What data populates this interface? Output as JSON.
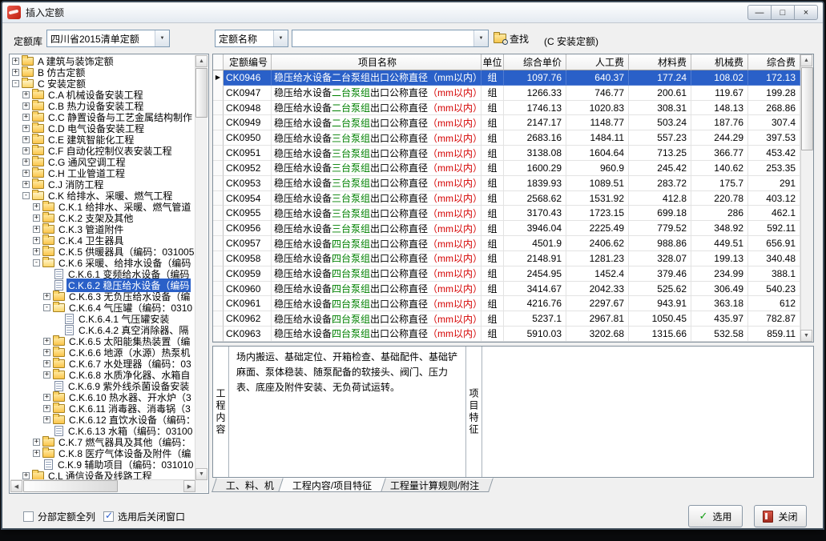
{
  "window": {
    "title": "插入定额",
    "minimize_glyph": "—",
    "maximize_glyph": "□",
    "close_glyph": "×"
  },
  "toolbar": {
    "library_label": "定额库",
    "library_value": "四川省2015清单定额",
    "name_combo_value": "定额名称",
    "search_value": "",
    "find_label": "查找",
    "category_note": "(C 安装定额)"
  },
  "colors": {
    "selection": "#2a60c8",
    "pump_text": "#008000",
    "paren_text": "#d40000"
  },
  "tree": {
    "items": [
      {
        "label": "A 建筑与装饰定额",
        "level": 0,
        "icon": "folder",
        "exp": "plus"
      },
      {
        "label": "B 仿古定额",
        "level": 0,
        "icon": "folder",
        "exp": "plus"
      },
      {
        "label": "C 安装定额",
        "level": 0,
        "icon": "folder-open",
        "exp": "minus"
      },
      {
        "label": "C.A 机械设备安装工程",
        "level": 1,
        "icon": "folder",
        "exp": "plus"
      },
      {
        "label": "C.B 热力设备安装工程",
        "level": 1,
        "icon": "folder",
        "exp": "plus"
      },
      {
        "label": "C.C 静置设备与工艺金属结构制作",
        "level": 1,
        "icon": "folder",
        "exp": "plus"
      },
      {
        "label": "C.D 电气设备安装工程",
        "level": 1,
        "icon": "folder",
        "exp": "plus"
      },
      {
        "label": "C.E 建筑智能化工程",
        "level": 1,
        "icon": "folder",
        "exp": "plus"
      },
      {
        "label": "C.F 自动化控制仪表安装工程",
        "level": 1,
        "icon": "folder",
        "exp": "plus"
      },
      {
        "label": "C.G 通风空调工程",
        "level": 1,
        "icon": "folder",
        "exp": "plus"
      },
      {
        "label": "C.H 工业管道工程",
        "level": 1,
        "icon": "folder",
        "exp": "plus"
      },
      {
        "label": "C.J 消防工程",
        "level": 1,
        "icon": "folder",
        "exp": "plus"
      },
      {
        "label": "C.K 给排水、采暖、燃气工程",
        "level": 1,
        "icon": "folder-open",
        "exp": "minus"
      },
      {
        "label": "C.K.1 给排水、采暖、燃气管道",
        "level": 2,
        "icon": "folder",
        "exp": "plus"
      },
      {
        "label": "C.K.2 支架及其他",
        "level": 2,
        "icon": "folder",
        "exp": "plus"
      },
      {
        "label": "C.K.3 管道附件",
        "level": 2,
        "icon": "folder",
        "exp": "plus"
      },
      {
        "label": "C.K.4 卫生器具",
        "level": 2,
        "icon": "folder",
        "exp": "plus"
      },
      {
        "label": "C.K.5 供暖器具（编码：031005",
        "level": 2,
        "icon": "folder",
        "exp": "plus"
      },
      {
        "label": "C.K.6 采暖、给排水设备（编码",
        "level": 2,
        "icon": "folder-open",
        "exp": "minus"
      },
      {
        "label": "C.K.6.1 变频给水设备（编码",
        "level": 3,
        "icon": "doc",
        "exp": "none"
      },
      {
        "label": "C.K.6.2 稳压给水设备（编码",
        "level": 3,
        "icon": "doc",
        "exp": "none",
        "selected": true
      },
      {
        "label": "C.K.6.3 无负压给水设备（编",
        "level": 3,
        "icon": "folder",
        "exp": "plus"
      },
      {
        "label": "C.K.6.4 气压罐（编码：0310",
        "level": 3,
        "icon": "folder-open",
        "exp": "minus"
      },
      {
        "label": "C.K.6.4.1 气压罐安装",
        "level": 4,
        "icon": "doc",
        "exp": "none"
      },
      {
        "label": "C.K.6.4.2 真空消除器、隔",
        "level": 4,
        "icon": "doc",
        "exp": "none"
      },
      {
        "label": "C.K.6.5 太阳能集热装置（编",
        "level": 3,
        "icon": "folder",
        "exp": "plus"
      },
      {
        "label": "C.K.6.6 地源（水源）热泵机",
        "level": 3,
        "icon": "folder",
        "exp": "plus"
      },
      {
        "label": "C.K.6.7 水处理器（编码：03",
        "level": 3,
        "icon": "folder",
        "exp": "plus"
      },
      {
        "label": "C.K.6.8 水质净化器、水箱自",
        "level": 3,
        "icon": "folder",
        "exp": "plus"
      },
      {
        "label": "C.K.6.9 紫外线杀菌设备安装",
        "level": 3,
        "icon": "doc",
        "exp": "none"
      },
      {
        "label": "C.K.6.10 热水器、开水炉（3",
        "level": 3,
        "icon": "folder",
        "exp": "plus"
      },
      {
        "label": "C.K.6.11 消毒器、消毒锅（3",
        "level": 3,
        "icon": "folder",
        "exp": "plus"
      },
      {
        "label": "C.K.6.12 直饮水设备（编码：",
        "level": 3,
        "icon": "folder",
        "exp": "plus"
      },
      {
        "label": "C.K.6.13 水箱（编码：03100",
        "level": 3,
        "icon": "doc",
        "exp": "none"
      },
      {
        "label": "C.K.7 燃气器具及其他（编码：",
        "level": 2,
        "icon": "folder",
        "exp": "plus"
      },
      {
        "label": "C.K.8 医疗气体设备及附件（编",
        "level": 2,
        "icon": "folder",
        "exp": "plus"
      },
      {
        "label": "C.K.9 辅助项目（编码：031010",
        "level": 2,
        "icon": "doc",
        "exp": "none"
      },
      {
        "label": "C.L 通信设备及线路工程",
        "level": 1,
        "icon": "folder",
        "exp": "plus"
      }
    ]
  },
  "table": {
    "headers": [
      "定额编号",
      "项目名称",
      "单位",
      "综合单价",
      "人工费",
      "材料费",
      "机械费",
      "综合费"
    ],
    "selected_marker": "▶",
    "name_parts": {
      "prefix": "稳压给水设备",
      "mid": "出口公称直径",
      "paren": "（mm以内）"
    },
    "rows": [
      {
        "code": "CK0946",
        "pump": "二台泵组",
        "unit": "组",
        "price": "1097.76",
        "labor": "640.37",
        "material": "177.24",
        "machine": "108.02",
        "composite": "172.13",
        "selected": true
      },
      {
        "code": "CK0947",
        "pump": "二台泵组",
        "unit": "组",
        "price": "1266.33",
        "labor": "746.77",
        "material": "200.61",
        "machine": "119.67",
        "composite": "199.28"
      },
      {
        "code": "CK0948",
        "pump": "二台泵组",
        "unit": "组",
        "price": "1746.13",
        "labor": "1020.83",
        "material": "308.31",
        "machine": "148.13",
        "composite": "268.86"
      },
      {
        "code": "CK0949",
        "pump": "二台泵组",
        "unit": "组",
        "price": "2147.17",
        "labor": "1148.77",
        "material": "503.24",
        "machine": "187.76",
        "composite": "307.4"
      },
      {
        "code": "CK0950",
        "pump": "三台泵组",
        "unit": "组",
        "price": "2683.16",
        "labor": "1484.11",
        "material": "557.23",
        "machine": "244.29",
        "composite": "397.53"
      },
      {
        "code": "CK0951",
        "pump": "三台泵组",
        "unit": "组",
        "price": "3138.08",
        "labor": "1604.64",
        "material": "713.25",
        "machine": "366.77",
        "composite": "453.42"
      },
      {
        "code": "CK0952",
        "pump": "三台泵组",
        "unit": "组",
        "price": "1600.29",
        "labor": "960.9",
        "material": "245.42",
        "machine": "140.62",
        "composite": "253.35"
      },
      {
        "code": "CK0953",
        "pump": "三台泵组",
        "unit": "组",
        "price": "1839.93",
        "labor": "1089.51",
        "material": "283.72",
        "machine": "175.7",
        "composite": "291"
      },
      {
        "code": "CK0954",
        "pump": "三台泵组",
        "unit": "组",
        "price": "2568.62",
        "labor": "1531.92",
        "material": "412.8",
        "machine": "220.78",
        "composite": "403.12"
      },
      {
        "code": "CK0955",
        "pump": "三台泵组",
        "unit": "组",
        "price": "3170.43",
        "labor": "1723.15",
        "material": "699.18",
        "machine": "286",
        "composite": "462.1"
      },
      {
        "code": "CK0956",
        "pump": "三台泵组",
        "unit": "组",
        "price": "3946.04",
        "labor": "2225.49",
        "material": "779.52",
        "machine": "348.92",
        "composite": "592.11"
      },
      {
        "code": "CK0957",
        "pump": "四台泵组",
        "unit": "组",
        "price": "4501.9",
        "labor": "2406.62",
        "material": "988.86",
        "machine": "449.51",
        "composite": "656.91"
      },
      {
        "code": "CK0958",
        "pump": "四台泵组",
        "unit": "组",
        "price": "2148.91",
        "labor": "1281.23",
        "material": "328.07",
        "machine": "199.13",
        "composite": "340.48"
      },
      {
        "code": "CK0959",
        "pump": "四台泵组",
        "unit": "组",
        "price": "2454.95",
        "labor": "1452.4",
        "material": "379.46",
        "machine": "234.99",
        "composite": "388.1"
      },
      {
        "code": "CK0960",
        "pump": "四台泵组",
        "unit": "组",
        "price": "3414.67",
        "labor": "2042.33",
        "material": "525.62",
        "machine": "306.49",
        "composite": "540.23"
      },
      {
        "code": "CK0961",
        "pump": "四台泵组",
        "unit": "组",
        "price": "4216.76",
        "labor": "2297.67",
        "material": "943.91",
        "machine": "363.18",
        "composite": "612"
      },
      {
        "code": "CK0962",
        "pump": "四台泵组",
        "unit": "组",
        "price": "5237.1",
        "labor": "2967.81",
        "material": "1050.45",
        "machine": "435.97",
        "composite": "782.87"
      },
      {
        "code": "CK0963",
        "pump": "四台泵组",
        "unit": "组",
        "price": "5910.03",
        "labor": "3202.68",
        "material": "1315.66",
        "machine": "532.58",
        "composite": "859.11"
      }
    ]
  },
  "detail": {
    "content_label": "工程内容",
    "content_text": "场内搬运、基础定位、开箱检查、基础配件、基础铲麻面、泵体稳装、随泵配备的软接头、阀门、压力表、底座及附件安装、无负荷试运转。",
    "feature_label": "项目特征",
    "feature_text": ""
  },
  "tabs": [
    {
      "label": "工、料、机",
      "active": false
    },
    {
      "label": "工程内容/项目特征",
      "active": true
    },
    {
      "label": "工程量计算规则/附注",
      "active": false
    }
  ],
  "footer": {
    "checkbox1": {
      "label": "分部定额全列",
      "checked": false
    },
    "checkbox2": {
      "label": "选用后关闭窗口",
      "checked": true
    },
    "select_label": "选用",
    "close_label": "关闭"
  }
}
